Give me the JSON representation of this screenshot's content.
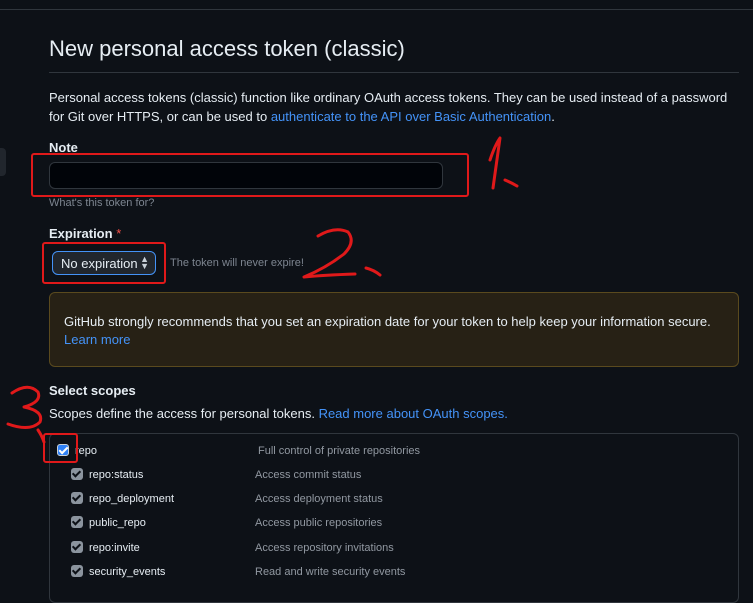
{
  "page": {
    "title": "New personal access token (classic)",
    "intro_text": "Personal access tokens (classic) function like ordinary OAuth access tokens. They can be used instead of a password for Git over HTTPS, or can be used to ",
    "intro_link": "authenticate to the API over Basic Authentication",
    "intro_end": "."
  },
  "note": {
    "label": "Note",
    "value": "",
    "placeholder": "",
    "hint": "What's this token for?"
  },
  "expiration": {
    "label": "Expiration",
    "required_mark": "*",
    "selected": "No expiration",
    "hint": "The token will never expire!"
  },
  "warning": {
    "text": "GitHub strongly recommends that you set an expiration date for your token to help keep your information secure.",
    "link": "Learn more"
  },
  "scopes": {
    "title": "Select scopes",
    "description": "Scopes define the access for personal tokens.",
    "description_link": "Read more about OAuth scopes.",
    "items": [
      {
        "name": "repo",
        "desc": "Full control of private repositories",
        "checked": true
      },
      {
        "name": "repo:status",
        "desc": "Access commit status",
        "checked": true
      },
      {
        "name": "repo_deployment",
        "desc": "Access deployment status",
        "checked": true
      },
      {
        "name": "public_repo",
        "desc": "Access public repositories",
        "checked": true
      },
      {
        "name": "repo:invite",
        "desc": "Access repository invitations",
        "checked": true
      },
      {
        "name": "security_events",
        "desc": "Read and write security events",
        "checked": true
      }
    ]
  },
  "annotations": {
    "one": "1.",
    "two": "2.",
    "three": "3"
  },
  "colors": {
    "background": "#0d1117",
    "link": "#4493f8",
    "annotation_red": "#e0191a",
    "checkbox_blue": "#2f81f7"
  }
}
